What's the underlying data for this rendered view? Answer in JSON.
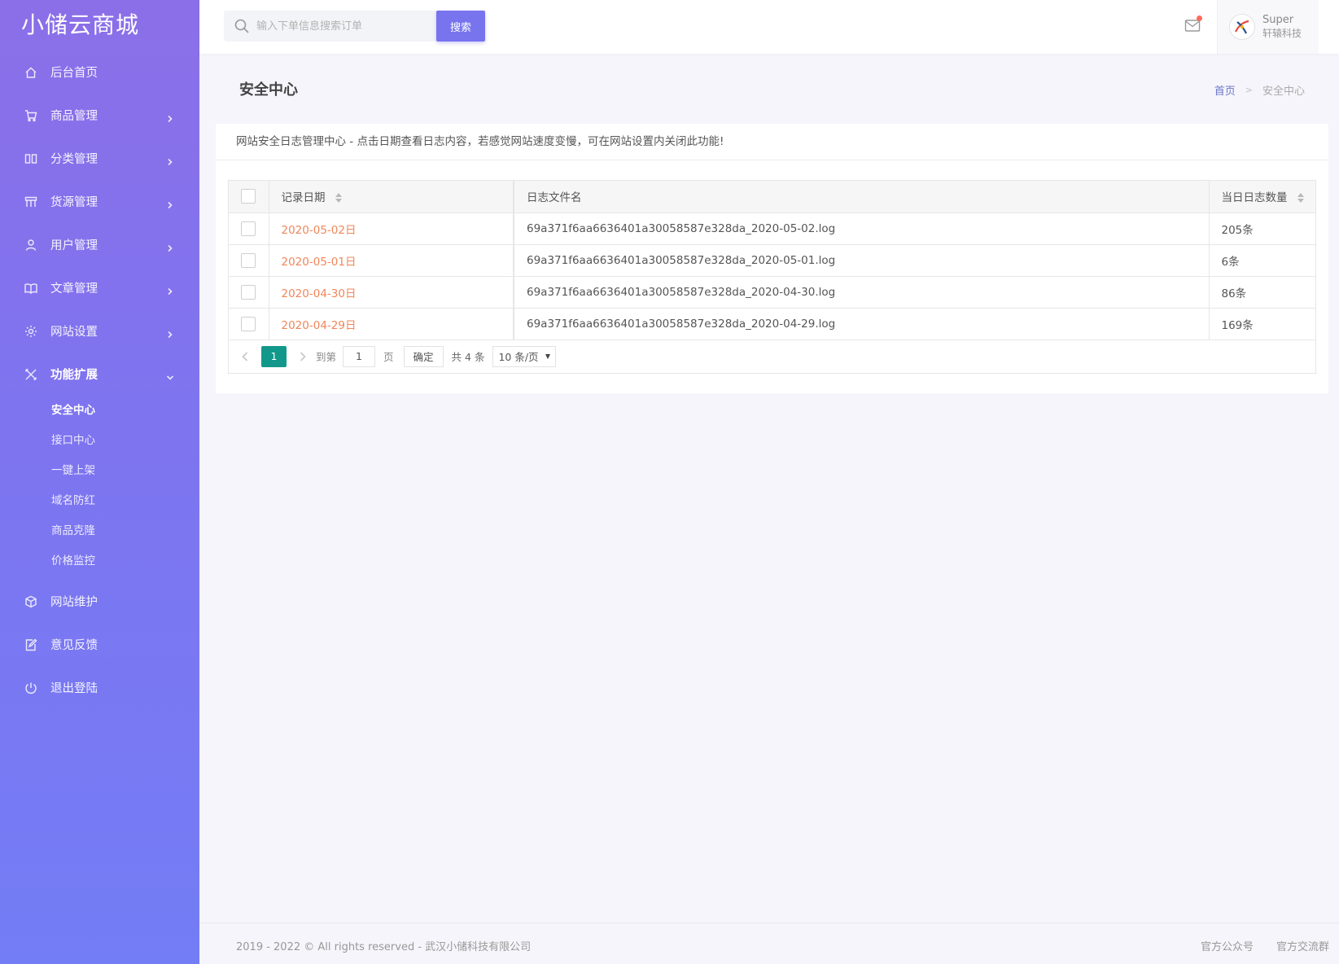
{
  "sidebar": {
    "logo": "小储云商城",
    "items": [
      {
        "label": "后台首页"
      },
      {
        "label": "商品管理"
      },
      {
        "label": "分类管理"
      },
      {
        "label": "货源管理"
      },
      {
        "label": "用户管理"
      },
      {
        "label": "文章管理"
      },
      {
        "label": "网站设置"
      },
      {
        "label": "功能扩展"
      },
      {
        "label": "网站维护"
      },
      {
        "label": "意见反馈"
      },
      {
        "label": "退出登陆"
      }
    ],
    "submenu": [
      {
        "label": "安全中心"
      },
      {
        "label": "接口中心"
      },
      {
        "label": "一键上架"
      },
      {
        "label": "域名防红"
      },
      {
        "label": "商品克隆"
      },
      {
        "label": "价格监控"
      }
    ]
  },
  "header": {
    "search_placeholder": "输入下单信息搜索订单",
    "search_button": "搜索",
    "user_name": "Super",
    "user_org": "轩辕科技"
  },
  "page": {
    "title": "安全中心",
    "breadcrumb_home": "首页",
    "breadcrumb_sep": ">",
    "breadcrumb_current": "安全中心"
  },
  "card": {
    "notice": "网站安全日志管理中心 - 点击日期查看日志内容，若感觉网站速度变慢，可在网站设置内关闭此功能!"
  },
  "table": {
    "headers": {
      "date": "记录日期",
      "file": "日志文件名",
      "count": "当日日志数量"
    },
    "rows": [
      {
        "date": "2020-05-02日",
        "file": "69a371f6aa6636401a30058587e328da_2020-05-02.log",
        "count": "205条"
      },
      {
        "date": "2020-05-01日",
        "file": "69a371f6aa6636401a30058587e328da_2020-05-01.log",
        "count": "6条"
      },
      {
        "date": "2020-04-30日",
        "file": "69a371f6aa6636401a30058587e328da_2020-04-30.log",
        "count": "86条"
      },
      {
        "date": "2020-04-29日",
        "file": "69a371f6aa6636401a30058587e328da_2020-04-29.log",
        "count": "169条"
      }
    ]
  },
  "pager": {
    "current": "1",
    "goto_label": "到第",
    "goto_value": "1",
    "page_label": "页",
    "confirm": "确定",
    "total": "共 4 条",
    "page_size": "10 条/页"
  },
  "footer": {
    "copyright": "2019 - 2022 © All rights reserved - 武汉小储科技有限公司",
    "link1": "官方公众号",
    "link2": "官方交流群"
  },
  "colors": {
    "sidebar_top": "#8b6fe8",
    "sidebar_bottom": "#737df5",
    "accent": "#7774ee",
    "pager_active": "#11988a",
    "date_link": "#f0865a"
  }
}
